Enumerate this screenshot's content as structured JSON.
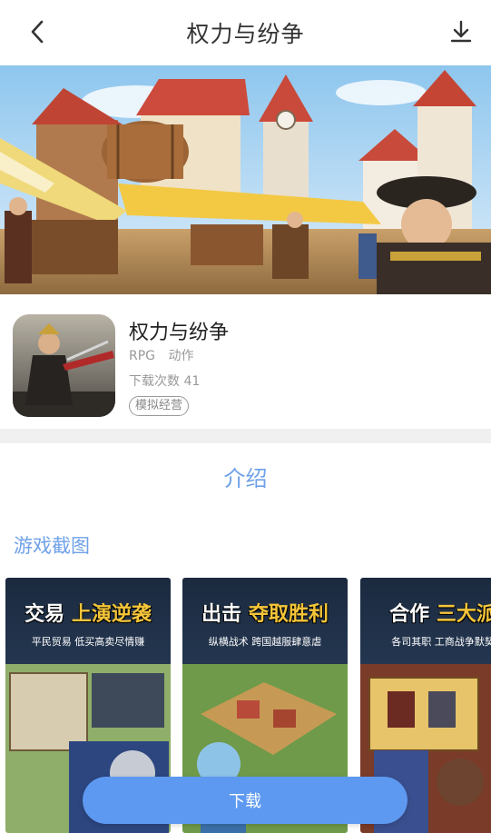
{
  "header": {
    "title": "权力与纷争",
    "back_icon": "chevron-left-icon",
    "download_icon": "download-icon"
  },
  "app": {
    "name": "权力与纷争",
    "categories": [
      "RPG",
      "动作"
    ],
    "downloads": "下载次数 41",
    "tag": "模拟经营"
  },
  "tabs": {
    "intro": "介绍"
  },
  "screenshots": {
    "title": "游戏截图",
    "items": [
      {
        "title_a": "交易",
        "title_b": "上演逆袭",
        "subtitle": "平民贸易 低买高卖尽情赚"
      },
      {
        "title_a": "出击",
        "title_b": "夺取胜利",
        "subtitle": "纵横战术 跨国越服肆意虐"
      },
      {
        "title_a": "合作",
        "title_b": "三大派",
        "subtitle": "各司其职 工商战争默契"
      }
    ]
  },
  "download_button": {
    "label": "下载"
  },
  "colors": {
    "accent": "#5d99f0",
    "section": "#6fa1e8"
  }
}
